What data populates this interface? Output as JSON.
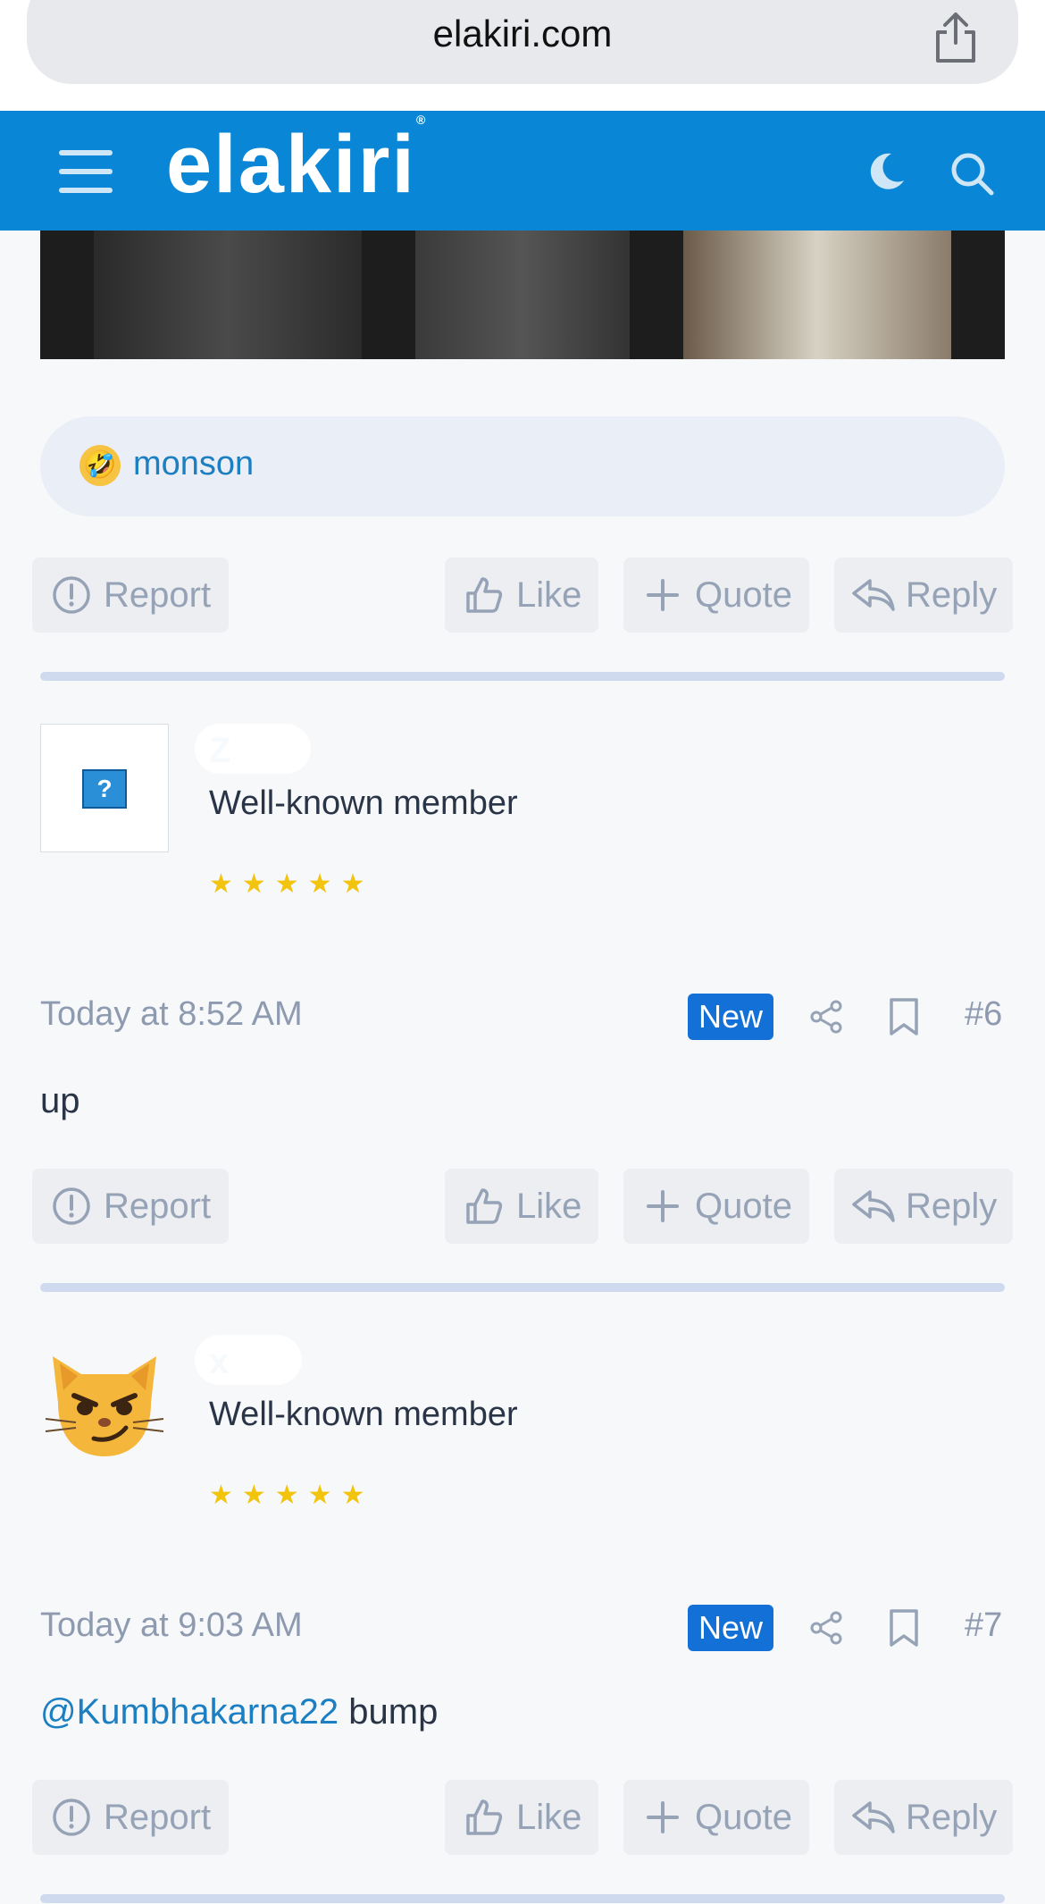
{
  "browser": {
    "url": "elakiri.com"
  },
  "header": {
    "logo": "elakiri",
    "logo_mark": "®"
  },
  "reaction": {
    "emoji": "🤣",
    "user": "monson"
  },
  "actions": {
    "report": "Report",
    "like": "Like",
    "quote": "Quote",
    "reply": "Reply"
  },
  "posts": [
    {
      "username": "Z",
      "role": "Well-known member",
      "stars": "★★★★★",
      "timestamp": "Today at 8:52 AM",
      "badge": "New",
      "number": "#6",
      "body": "up"
    },
    {
      "username": "x",
      "role": "Well-known member",
      "stars": "★★★★★",
      "timestamp": "Today at 9:03 AM",
      "badge": "New",
      "number": "#7",
      "mention": "@Kumbhakarna22",
      "body": " bump"
    }
  ],
  "colors": {
    "brand": "#0a86d6",
    "link": "#1b7fc1",
    "badge": "#1370d6",
    "star": "#f2c40d"
  }
}
